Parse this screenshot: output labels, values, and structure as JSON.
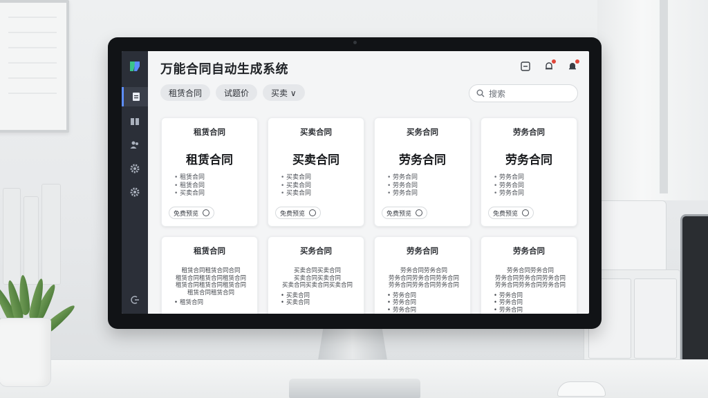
{
  "app": {
    "title": "万能合同自动生成系统"
  },
  "filters": {
    "chips": [
      {
        "label": "租赁合同"
      },
      {
        "label": "试题价"
      },
      {
        "label": "买卖 ∨"
      }
    ]
  },
  "search": {
    "placeholder": "搜索"
  },
  "header_icons": [
    "minimize-icon",
    "bell-icon",
    "notification-icon"
  ],
  "sidebar": {
    "items": [
      "document-icon",
      "book-icon",
      "users-icon",
      "gear-icon",
      "settings-icon",
      "logout-icon"
    ]
  },
  "cards_top": [
    {
      "head": "租赁合同",
      "title": "租赁合同",
      "items": [
        "租赁合同",
        "租赁合同",
        "买卖合同"
      ],
      "button": "免费预览"
    },
    {
      "head": "买卖合同",
      "title": "买卖合同",
      "items": [
        "买卖合同",
        "买卖合同",
        "买卖合同"
      ],
      "button": "免费预览"
    },
    {
      "head": "买务合同",
      "title": "劳务合同",
      "items": [
        "劳务合同",
        "劳务合同",
        "劳务合同"
      ],
      "button": "免费预览"
    },
    {
      "head": "劳务合同",
      "title": "劳务合同",
      "items": [
        "劳务合同",
        "劳务合同",
        "劳务合同"
      ],
      "button": "免费预览"
    }
  ],
  "cards_bottom": [
    {
      "head": "租赁合同",
      "lines": [
        "租赁合同租赁合同合同",
        "租赁合同租赁合同租赁合同",
        "租赁合同租赁合同租赁合同",
        "租赁合同租赁合同"
      ],
      "items": [
        "租赁合同"
      ]
    },
    {
      "head": "买务合同",
      "lines": [
        "买卖合同买卖合同",
        "买卖合同买卖合同",
        "买卖合同买卖合同买卖合同"
      ],
      "items": [
        "买卖合同",
        "买卖合同"
      ]
    },
    {
      "head": "劳务合同",
      "lines": [
        "劳务合同劳务合同",
        "劳务合同劳务合同劳务合同",
        "劳务合同劳务合同劳务合同"
      ],
      "items": [
        "劳务合同",
        "劳务合同",
        "劳务合同"
      ]
    },
    {
      "head": "劳务合同",
      "lines": [
        "劳务合同劳务合同",
        "劳务合同劳务合同劳务合同",
        "劳务合同劳务合同劳务合同"
      ],
      "items": [
        "劳务合同",
        "劳务合同",
        "劳务合同"
      ]
    }
  ],
  "colors": {
    "sidebar_bg": "#2b2f38",
    "accent": "#5c8dff",
    "notification_dot": "#e0463a"
  }
}
